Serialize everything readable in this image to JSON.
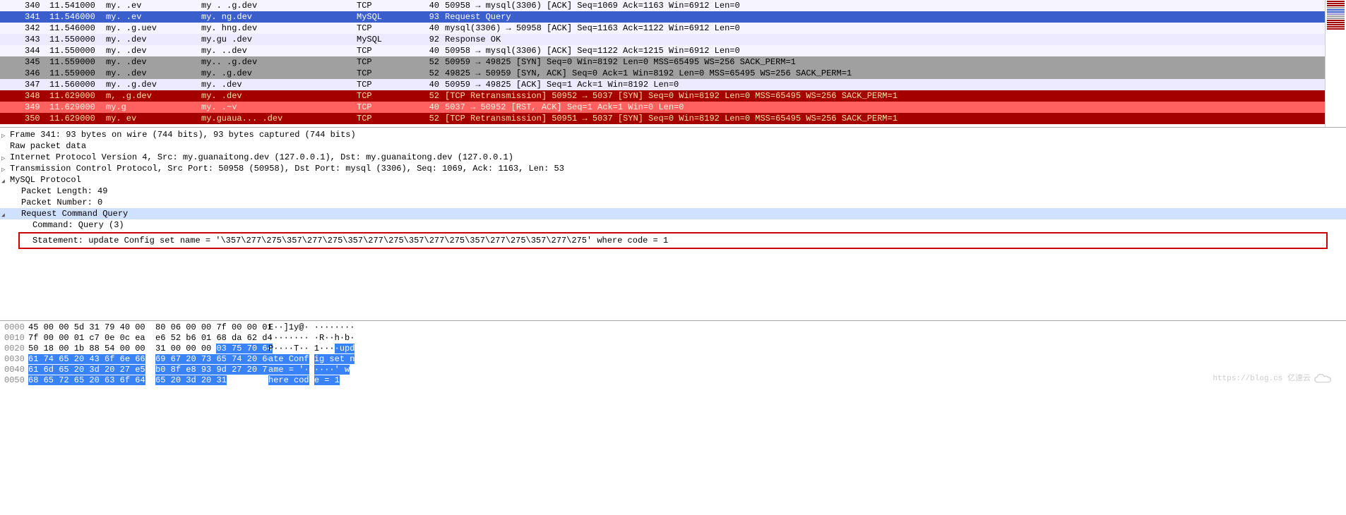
{
  "packets": [
    {
      "no": "340",
      "time": "11.541000",
      "src": "my.           .ev",
      "dst": "my .           .g.dev",
      "proto": "TCP",
      "len": "40",
      "info": "50958 → mysql(3306) [ACK] Seq=1069 Ack=1163 Win=6912 Len=0",
      "cls": "normal-odd"
    },
    {
      "no": "341",
      "time": "11.546000",
      "src": "my.           .ev",
      "dst": "my.            ng.dev",
      "proto": "MySQL",
      "len": "93",
      "info": "Request Query",
      "cls": "selected"
    },
    {
      "no": "342",
      "time": "11.546000",
      "src": "my.         .g.uev",
      "dst": "my.           hng.dev",
      "proto": "TCP",
      "len": "40",
      "info": "mysql(3306) → 50958 [ACK] Seq=1163 Ack=1122 Win=6912 Len=0",
      "cls": "normal-odd"
    },
    {
      "no": "343",
      "time": "11.550000",
      "src": "my.          .dev",
      "dst": "my.gu          .dev",
      "proto": "MySQL",
      "len": "92",
      "info": "Response OK",
      "cls": "normal-even"
    },
    {
      "no": "344",
      "time": "11.550000",
      "src": "my.          .dev",
      "dst": "my.           ..dev",
      "proto": "TCP",
      "len": "40",
      "info": "50958 → mysql(3306) [ACK] Seq=1122 Ack=1215 Win=6912 Len=0",
      "cls": "normal-odd"
    },
    {
      "no": "345",
      "time": "11.559000",
      "src": "my.          .dev",
      "dst": "my..         .g.dev",
      "proto": "TCP",
      "len": "52",
      "info": "50959 → 49825 [SYN] Seq=0 Win=8192 Len=0 MSS=65495 WS=256 SACK_PERM=1",
      "cls": "gray"
    },
    {
      "no": "346",
      "time": "11.559000",
      "src": "my.          .dev",
      "dst": "my.          .g.dev",
      "proto": "TCP",
      "len": "52",
      "info": "49825 → 50959 [SYN, ACK] Seq=0 Ack=1 Win=8192 Len=0 MSS=65495 WS=256 SACK_PERM=1",
      "cls": "gray"
    },
    {
      "no": "347",
      "time": "11.560000",
      "src": "my.         .g.dev",
      "dst": "my.          .dev",
      "proto": "TCP",
      "len": "40",
      "info": "50959 → 49825 [ACK] Seq=1 Ack=1 Win=8192 Len=0",
      "cls": "normal-even"
    },
    {
      "no": "348",
      "time": "11.629000",
      "src": "m,         .g.dev",
      "dst": "my.          .dev",
      "proto": "TCP",
      "len": "52",
      "info": "[TCP Retransmission] 50952 → 5037 [SYN] Seq=0 Win=8192 Len=0 MSS=65495 WS=256 SACK_PERM=1",
      "cls": "red-dark"
    },
    {
      "no": "349",
      "time": "11.629000",
      "src": "my.g            ",
      "dst": "my.           .~v",
      "proto": "TCP",
      "len": "40",
      "info": "5037 → 50952 [RST, ACK] Seq=1 Ack=1 Win=0 Len=0",
      "cls": "red-light"
    },
    {
      "no": "350",
      "time": "11.629000",
      "src": "my.           ev",
      "dst": "my.guaua...   .dev",
      "proto": "TCP",
      "len": "52",
      "info": "[TCP Retransmission] 50951 → 5037 [SYN] Seq=0 Win=8192 Len=0 MSS=65495 WS=256 SACK_PERM=1",
      "cls": "red-dark"
    }
  ],
  "minimap": [
    "a40000",
    "a40000",
    "a40000",
    "a0a0a0",
    "3a5fcd",
    "3a5fcd",
    "ede9ff",
    "a0a0a0",
    "a0a0a0",
    "a40000",
    "a40000",
    "a40000",
    "a40000",
    "a40000"
  ],
  "details": {
    "frame": "Frame 341: 93 bytes on wire (744 bits), 93 bytes captured (744 bits)",
    "raw": "Raw packet data",
    "ip": "Internet Protocol Version 4, Src: my.guanaitong.dev (127.0.0.1), Dst: my.guanaitong.dev (127.0.0.1)",
    "tcp": "Transmission Control Protocol, Src Port: 50958 (50958), Dst Port: mysql (3306), Seq: 1069, Ack: 1163, Len: 53",
    "mysql": "MySQL Protocol",
    "pkt_len": "Packet Length: 49",
    "pkt_num": "Packet Number: 0",
    "req_cmd": "Request Command Query",
    "command": "Command: Query (3)",
    "statement": "Statement: update Config set name = '\\357\\277\\275\\357\\277\\275\\357\\277\\275\\357\\277\\275\\357\\277\\275\\357\\277\\275' where code = 1"
  },
  "hex": [
    {
      "off": "0000",
      "b1": "45 00 00 5d 31 79 40 00",
      "b2": "80 06 00 00 7f 00 00 01",
      "a1": "E··]1y@·",
      "a2": "········"
    },
    {
      "off": "0010",
      "b1": "7f 00 00 01 c7 0e 0c ea",
      "b2": "e6 52 b6 01 68 da 62 d4",
      "a1": "········",
      "a2": "·R··h·b·"
    },
    {
      "off": "0020",
      "b1": "50 18 00 1b 88 54 00 00",
      "b2": "31 00 00 00 ",
      "b2h": "03 75 70 64",
      "a1": "P····T··",
      "a2": "1···",
      "a2h": "·upd"
    },
    {
      "off": "0030",
      "b1h": "61 74 65 20 43 6f 6e 66",
      "b2h": "69 67 20 73 65 74 20 6e",
      "a1h": "ate Conf",
      "a2h": "ig set n"
    },
    {
      "off": "0040",
      "b1h": "61 6d 65 20 3d 20 27 e5",
      "b2h": "b0 8f e8 93 9d 27 20 77",
      "a1h": "ame = '·",
      "a2h": "····' w"
    },
    {
      "off": "0050",
      "b1h": "68 65 72 65 20 63 6f 64",
      "b2h": "65 20 3d 20 31",
      "a1h": "here cod",
      "a2h": "e = 1"
    }
  ],
  "watermark": "https://blog.cs   亿速云"
}
